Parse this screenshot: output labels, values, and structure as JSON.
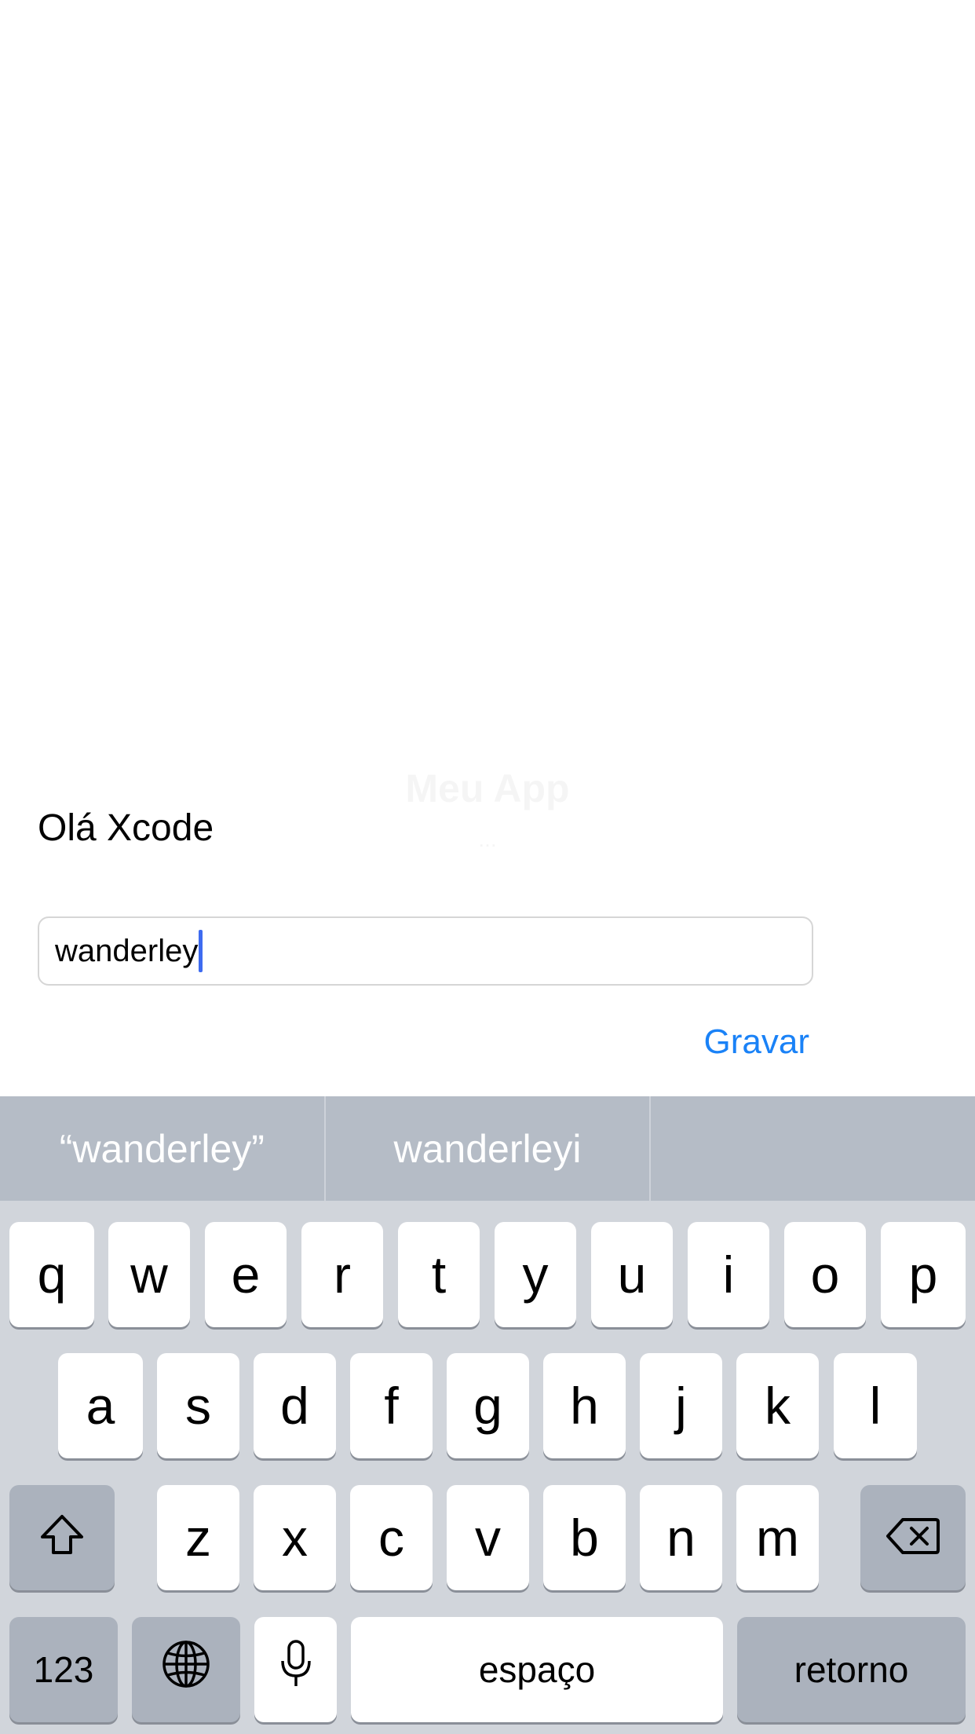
{
  "background_ghost": {
    "title": "Meu App",
    "subtitle": "..."
  },
  "greeting": "Olá Xcode",
  "name_field": {
    "value": "wanderley"
  },
  "save_button": "Gravar",
  "keyboard": {
    "suggestions": [
      "“wanderley”",
      "wanderleyi",
      ""
    ],
    "row1": [
      "q",
      "w",
      "e",
      "r",
      "t",
      "y",
      "u",
      "i",
      "o",
      "p"
    ],
    "row2": [
      "a",
      "s",
      "d",
      "f",
      "g",
      "h",
      "j",
      "k",
      "l"
    ],
    "row3": [
      "z",
      "x",
      "c",
      "v",
      "b",
      "n",
      "m"
    ],
    "numbers_key": "123",
    "space_key": "espaço",
    "return_key": "retorno",
    "icons": {
      "shift": "shift-icon",
      "backspace": "backspace-icon",
      "globe": "globe-icon",
      "microphone": "microphone-icon"
    }
  },
  "colors": {
    "accent": "#1a82f7",
    "caret": "#3e6bf0",
    "keyboard_bg": "#d1d5db",
    "suggestion_bar": "#b5bcc6",
    "dark_key": "#abb2bd"
  }
}
